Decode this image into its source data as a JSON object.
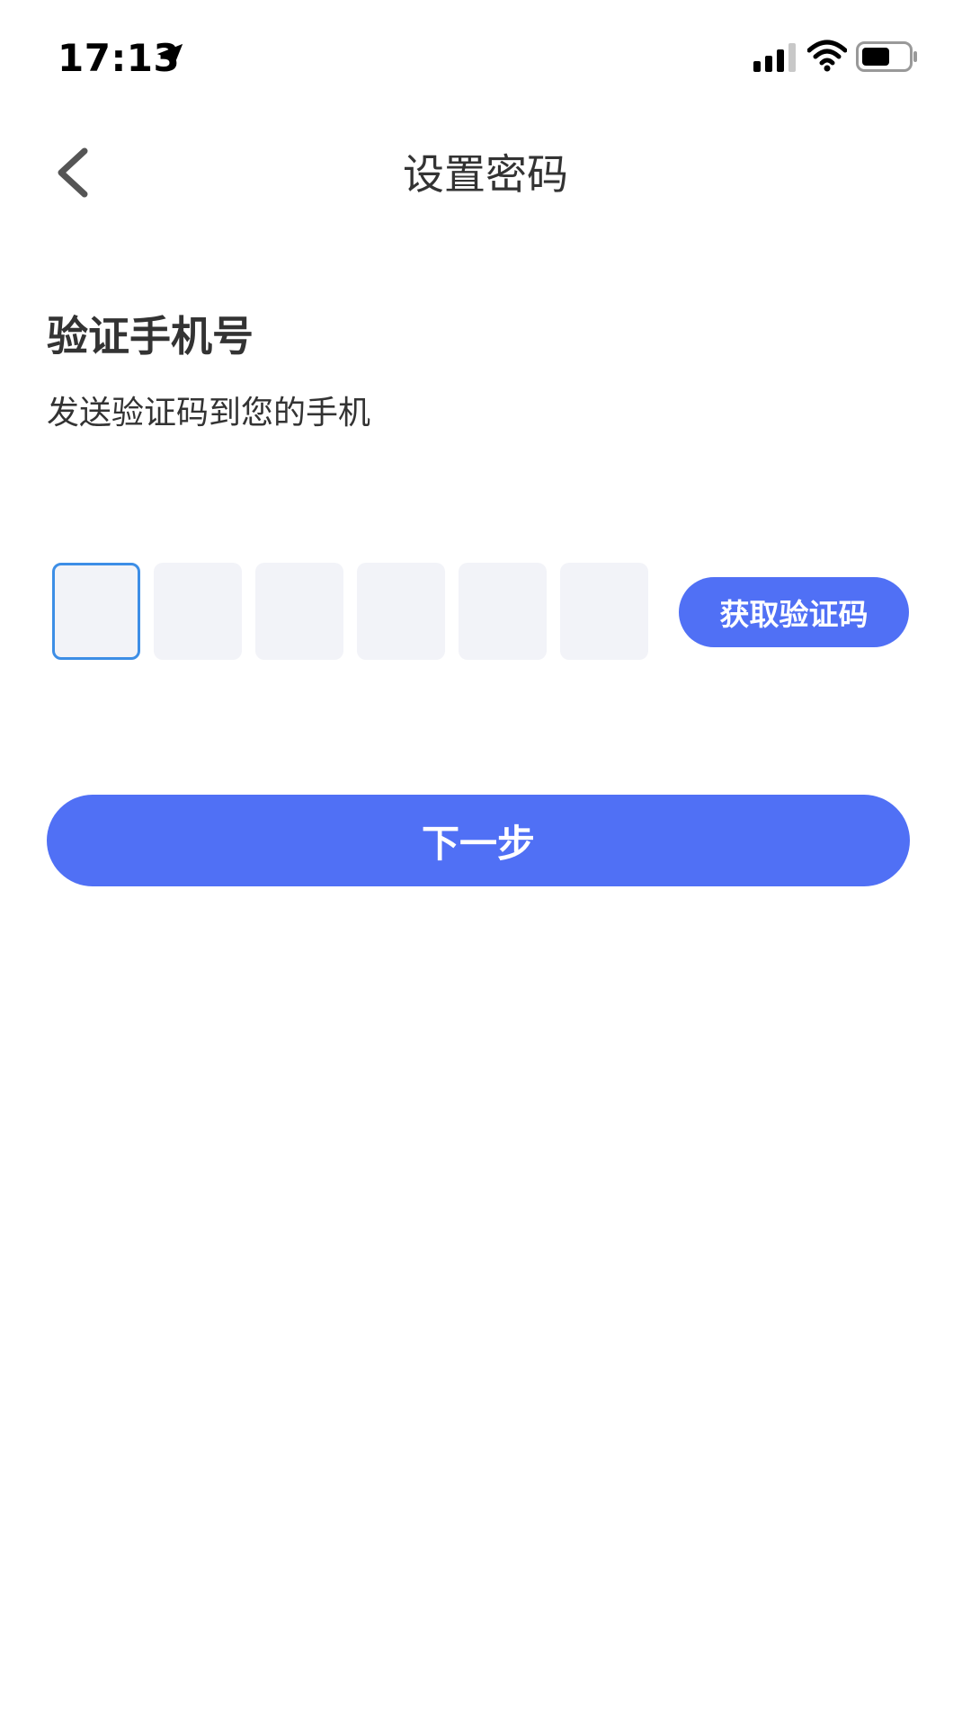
{
  "status_bar": {
    "time": "17:13",
    "icons": [
      "location-arrow-icon",
      "cellular-signal-icon",
      "wifi-icon",
      "battery-icon"
    ]
  },
  "header": {
    "back_icon": "chevron-left-icon",
    "title": "设置密码"
  },
  "verify": {
    "title": "验证手机号",
    "description": "发送验证码到您的手机"
  },
  "code_input": {
    "boxes": [
      "",
      "",
      "",
      "",
      "",
      ""
    ],
    "active_index": 0,
    "get_code_label": "获取验证码"
  },
  "actions": {
    "next_label": "下一步"
  },
  "colors": {
    "accent": "#5070f5",
    "focus_border": "#3d8ee6",
    "box_fill": "#f2f3f8",
    "text": "#333333"
  }
}
